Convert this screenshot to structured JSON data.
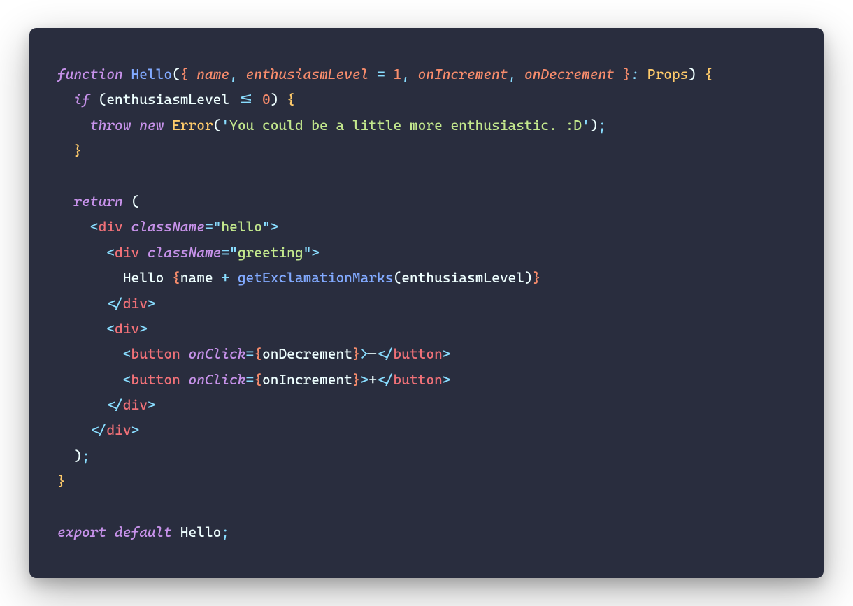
{
  "code": {
    "l1": {
      "kw_function": "function",
      "fn_name": "Hello",
      "p_name": "name",
      "p_enth": "enthusiasmLevel",
      "default_val": "1",
      "p_onInc": "onIncrement",
      "p_onDec": "onDecrement",
      "type": "Props"
    },
    "l2": {
      "kw_if": "if",
      "ident": "enthusiasmLevel",
      "op": "<=",
      "zero": "0"
    },
    "l3": {
      "kw_throw": "throw",
      "kw_new": "new",
      "cls": "Error",
      "msg": "You could be a little more enthusiastic. :D"
    },
    "l4": {
      "kw_return": "return"
    },
    "jsx": {
      "tag_div": "div",
      "tag_button": "button",
      "attr_className": "className",
      "attr_onClick": "onClick",
      "val_hello": "hello",
      "val_greeting": "greeting",
      "text_hello": "Hello ",
      "ident_name": "name",
      "fn_getMarks": "getExclamationMarks",
      "ident_enth": "enthusiasmLevel",
      "ident_onDec": "onDecrement",
      "ident_onInc": "onIncrement",
      "minus": "-",
      "plus": "+"
    },
    "l_export": {
      "kw_export": "export",
      "kw_default": "default",
      "ident": "Hello"
    }
  }
}
